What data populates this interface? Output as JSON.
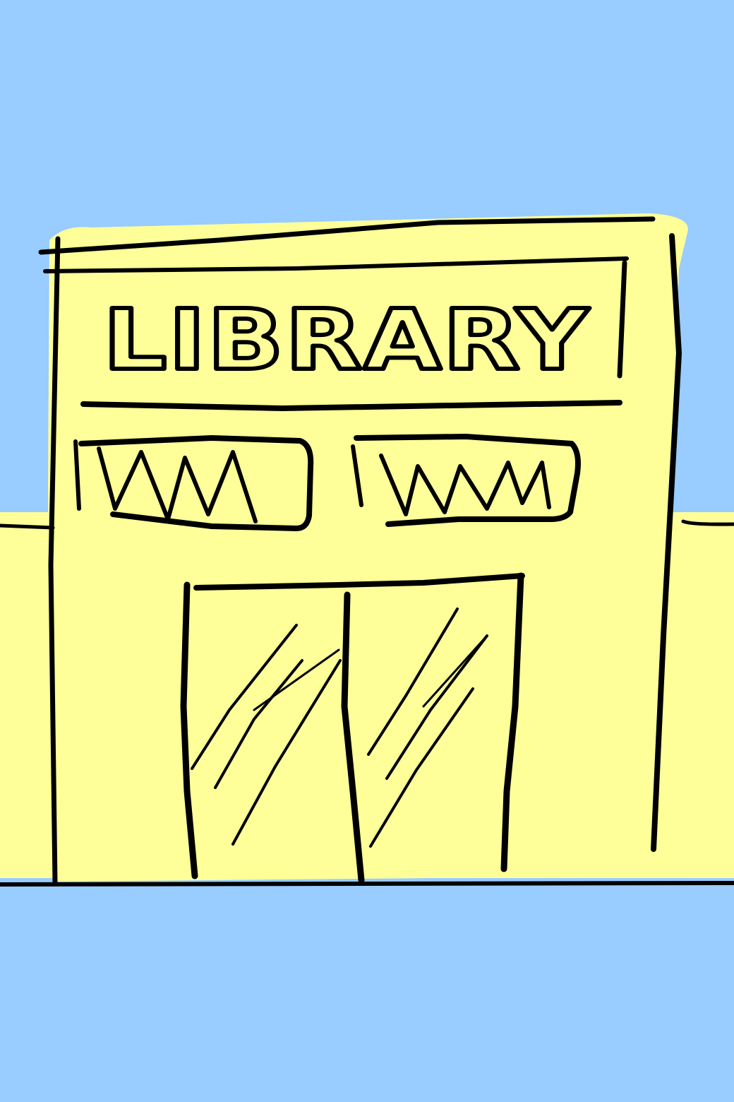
{
  "drawing": {
    "sign_text": "LIBRARY",
    "colors": {
      "sky": "#99ccff",
      "building": "#ffff99",
      "ground_strip": "#ffff99",
      "ink": "#000000"
    },
    "elements": [
      "sky",
      "building",
      "sign",
      "windows",
      "double-doors",
      "ground-line"
    ]
  }
}
